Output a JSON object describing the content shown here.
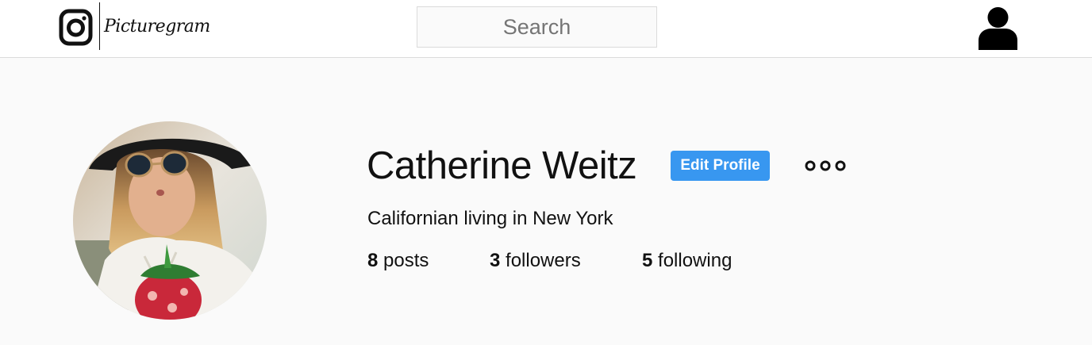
{
  "header": {
    "logo_text": "Picturegram",
    "search": {
      "placeholder": "Search"
    }
  },
  "profile": {
    "name": "Catherine Weitz",
    "edit_button_label": "Edit Profile",
    "bio": "Californian living in New York",
    "stats": [
      {
        "count": "8",
        "label": "posts"
      },
      {
        "count": "3",
        "label": "followers"
      },
      {
        "count": "5",
        "label": "following"
      }
    ]
  },
  "icons": {
    "logo": "camera-icon",
    "account": "user-icon",
    "options": "more-options-icon"
  },
  "colors": {
    "accent": "#3897f0",
    "page_background": "#fafafa",
    "header_background": "#ffffff",
    "border": "#dbdbdb"
  }
}
